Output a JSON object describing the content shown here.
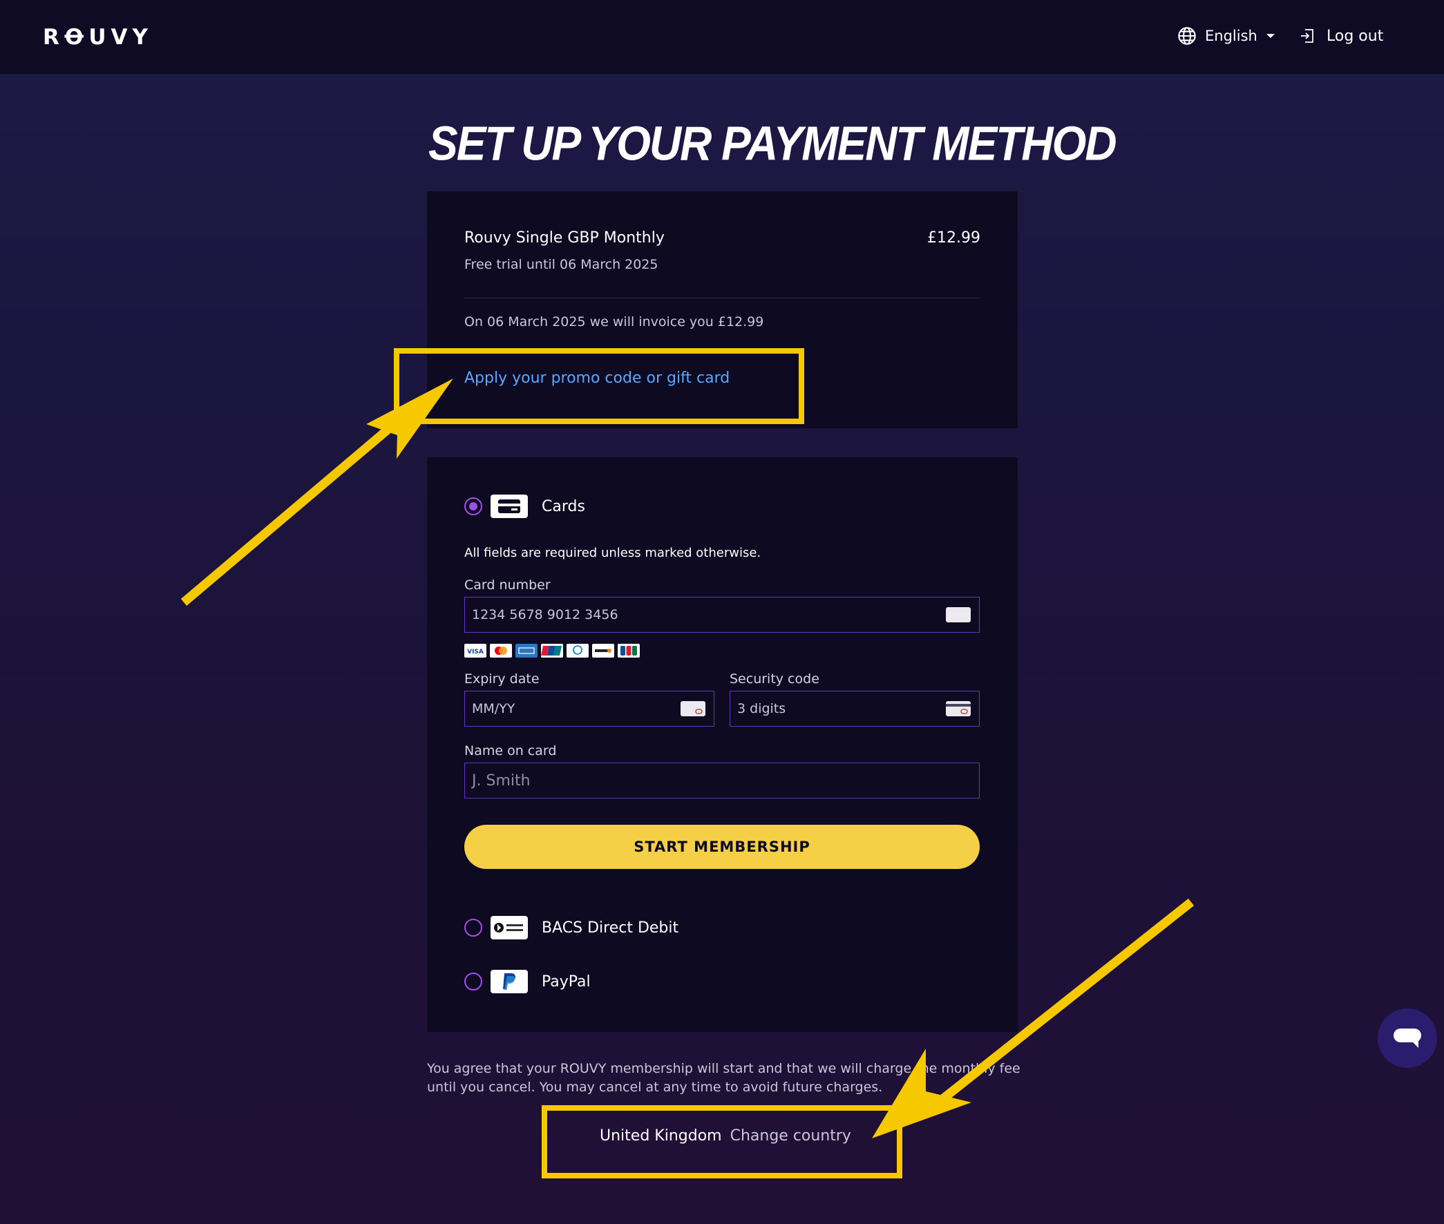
{
  "header": {
    "logo": "RꝊUVY",
    "language": "English",
    "logout_label": "Log out"
  },
  "page_title": "SET UP YOUR PAYMENT METHOD",
  "summary": {
    "plan_name": "Rouvy Single GBP Monthly",
    "price": "£12.99",
    "trial": "Free trial until 06 March 2025",
    "invoice": "On 06 March 2025 we will invoice you £12.99",
    "promo_link": "Apply your promo code or gift card"
  },
  "payment": {
    "cards_label": "Cards",
    "required_note": "All fields are required unless marked otherwise.",
    "card_number_label": "Card number",
    "card_number_placeholder": "1234 5678 9012 3456",
    "expiry_label": "Expiry date",
    "expiry_placeholder": "MM/YY",
    "security_label": "Security code",
    "security_placeholder": "3 digits",
    "name_label": "Name on card",
    "name_placeholder": "J. Smith",
    "submit": "START MEMBERSHIP",
    "bacs_label": "BACS Direct Debit",
    "paypal_label": "PayPal",
    "brands": [
      "visa",
      "mastercard",
      "amex",
      "unionpay",
      "diners",
      "discover",
      "jcb"
    ]
  },
  "terms": "You agree that your ROUVY membership will start and that we will charge the monthly fee until you cancel. You may cancel at any time to avoid future charges.",
  "country": {
    "name": "United Kingdom",
    "change_label": "Change country"
  },
  "colors": {
    "accent_yellow": "#f5cf46",
    "annotation_yellow": "#f5c800",
    "link_blue": "#59a7ff",
    "radio_purple": "#a04fe4",
    "field_border": "#5f39b8"
  }
}
